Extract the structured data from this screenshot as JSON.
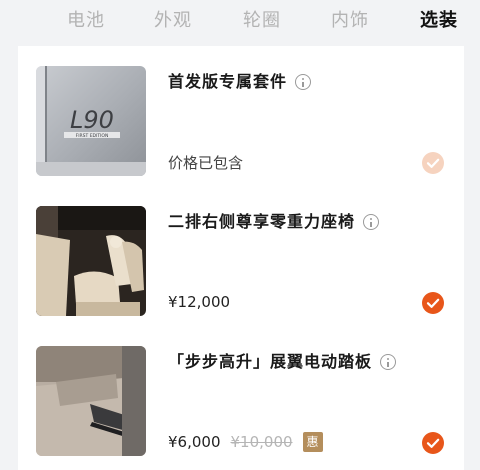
{
  "tabs": [
    {
      "label": "电池"
    },
    {
      "label": "外观"
    },
    {
      "label": "轮圈"
    },
    {
      "label": "内饰"
    },
    {
      "label": "选装"
    }
  ],
  "options": [
    {
      "title": "首发版专属套件",
      "price": "价格已包含",
      "selected": true,
      "included": true,
      "icon": "info-icon",
      "badge_text": "L90",
      "badge_subtext": "FIRST EDITION"
    },
    {
      "title": "二排右侧尊享零重力座椅",
      "price": "¥12,000",
      "selected": true,
      "icon": "info-icon"
    },
    {
      "title": "「步步高升」展翼电动踏板",
      "price": "¥6,000",
      "original_price": "¥10,000",
      "badge": "惠",
      "selected": true,
      "icon": "info-icon"
    }
  ],
  "colors": {
    "accent": "#e8561a",
    "accent_disabled": "#f6d3bf",
    "discount_badge": "#b48e5c"
  }
}
